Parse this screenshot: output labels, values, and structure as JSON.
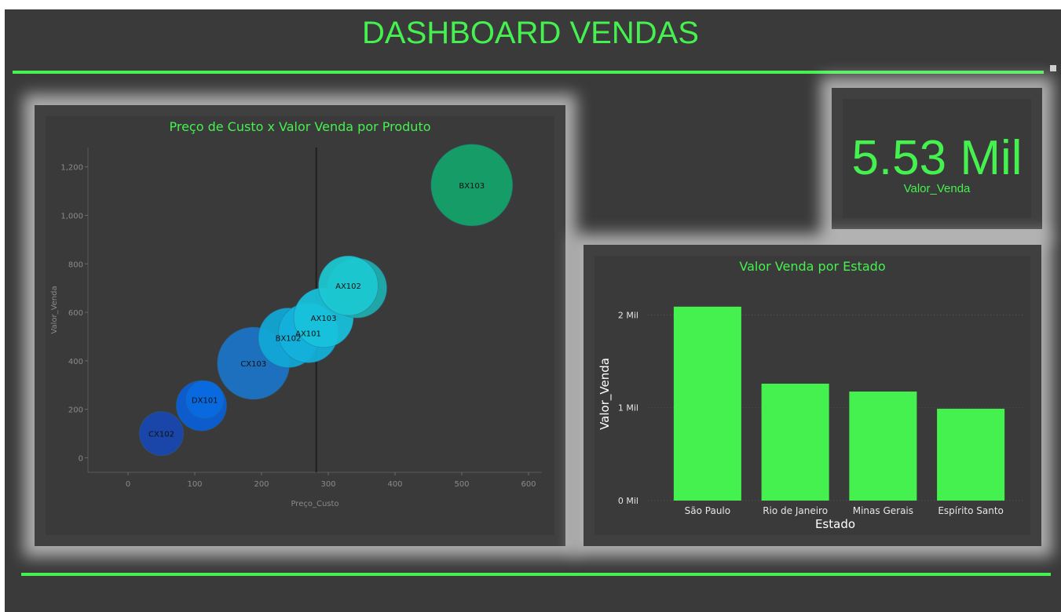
{
  "dashboard": {
    "title": "DASHBOARD VENDAS"
  },
  "colors": {
    "accent": "#45f14f",
    "background": "#3a3a3a"
  },
  "kpi": {
    "value": "5.53 Mil",
    "label": "Valor_Venda"
  },
  "chart_data": [
    {
      "type": "scatter",
      "title": "Preço de Custo x Valor Venda por Produto",
      "xlabel": "Preço_Custo",
      "ylabel": "Valor_Venda",
      "xlim": [
        -60,
        620
      ],
      "ylim": [
        -60,
        1280
      ],
      "xticks": [
        0,
        100,
        200,
        300,
        400,
        500,
        600
      ],
      "yticks": [
        0,
        200,
        400,
        600,
        800,
        1000,
        1200
      ],
      "ytick_labels": [
        "0",
        "200",
        "400",
        "600",
        "800",
        "1,000",
        "1,200"
      ],
      "reference_line_x": 282,
      "points": [
        {
          "label": "CX102",
          "x": 50,
          "y": 100,
          "size": 28,
          "color": "#1747b0"
        },
        {
          "label": "",
          "x": 110,
          "y": 215,
          "size": 32,
          "color": "#0a5fd8"
        },
        {
          "label": "DX101",
          "x": 115,
          "y": 240,
          "size": 24,
          "color": "#0a6ae0"
        },
        {
          "label": "CX103",
          "x": 188,
          "y": 390,
          "size": 46,
          "color": "#1a74c8"
        },
        {
          "label": "BX102",
          "x": 240,
          "y": 495,
          "size": 38,
          "color": "#10a8d6"
        },
        {
          "label": "AX101",
          "x": 270,
          "y": 515,
          "size": 38,
          "color": "#12b2dc"
        },
        {
          "label": "AX103",
          "x": 293,
          "y": 578,
          "size": 38,
          "color": "#18c2dc"
        },
        {
          "label": "",
          "x": 343,
          "y": 700,
          "size": 38,
          "color": "#1eaeae"
        },
        {
          "label": "AX102",
          "x": 330,
          "y": 710,
          "size": 38,
          "color": "#1cc8d2"
        },
        {
          "label": "BX103",
          "x": 515,
          "y": 1125,
          "size": 52,
          "color": "#12a46a"
        }
      ]
    },
    {
      "type": "bar",
      "title": "Valor Venda por Estado",
      "xlabel": "Estado",
      "ylabel": "Valor_Venda",
      "ylim": [
        0,
        2300
      ],
      "yticks": [
        0,
        1000,
        2000
      ],
      "ytick_labels": [
        "0 Mil",
        "1 Mil",
        "2 Mil"
      ],
      "categories": [
        "São Paulo",
        "Rio de Janeiro",
        "Minas Gerais",
        "Espírito Santo"
      ],
      "values": [
        2090,
        1260,
        1175,
        990
      ],
      "bar_color": "#45f14f"
    }
  ]
}
